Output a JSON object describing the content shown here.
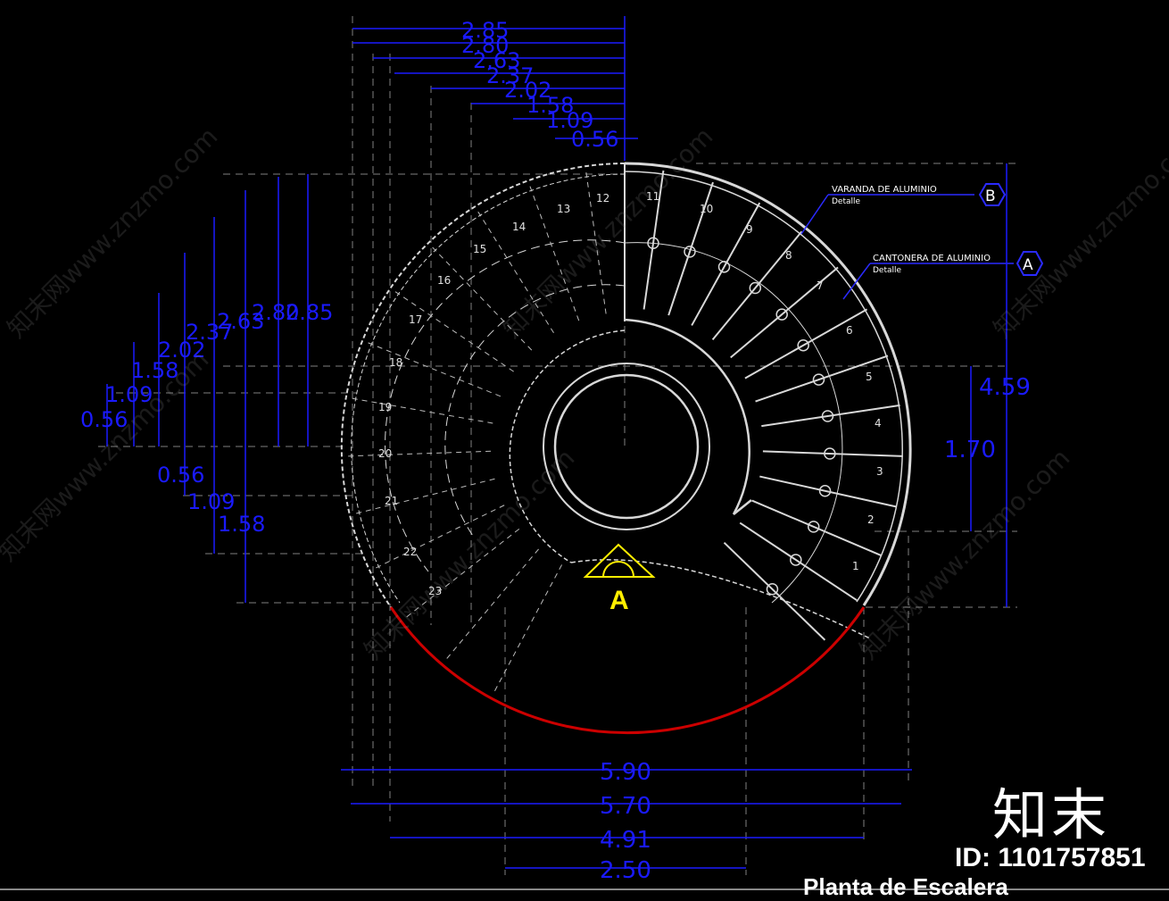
{
  "top_dims": [
    "2.85",
    "2.80",
    "2.63",
    "2.37",
    "2.02",
    "1.58",
    "1.09",
    "0.56"
  ],
  "left_dims": [
    "2.85",
    "2.80",
    "2.63",
    "2.37",
    "2.02",
    "1.58",
    "1.09",
    "0.56"
  ],
  "left_lower_dims": [
    "0.56",
    "1.09",
    "1.58"
  ],
  "right_dims": [
    "4.59",
    "1.70"
  ],
  "bottom_dims": [
    "5.90",
    "5.70",
    "4.91",
    "2.50"
  ],
  "steps": [
    "1",
    "2",
    "3",
    "4",
    "5",
    "6",
    "7",
    "8",
    "9",
    "10",
    "11",
    "12",
    "13",
    "14",
    "15",
    "16",
    "17",
    "18",
    "19",
    "20",
    "21",
    "22",
    "23"
  ],
  "callouts": [
    {
      "title": "VARANDA DE ALUMINIO",
      "sub": "Detalle",
      "tag": "B"
    },
    {
      "title": "CANTONERA DE ALUMINIO",
      "sub": "Detalle",
      "tag": "A"
    }
  ],
  "section_marker": "A",
  "watermark_text": "知末网www.znzmo.com",
  "brand": "知末",
  "id_label": "ID: 1101757851",
  "plan_title": "Planta de Escalera",
  "colors": {
    "dimension": "#1a1aff",
    "line": "#d8d8d8",
    "arc": "#cc0000",
    "marker": "#ffee00"
  }
}
